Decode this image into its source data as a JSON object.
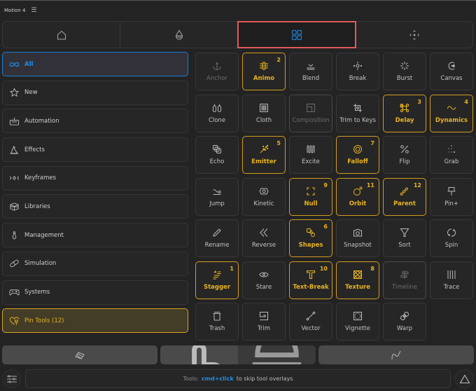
{
  "window": {
    "title": "Motion 4",
    "menu_icon": "hamburger-icon"
  },
  "nav_tabs": [
    {
      "name": "home",
      "icon": "home-icon",
      "active": false
    },
    {
      "name": "layers",
      "icon": "drop-icon",
      "active": false
    },
    {
      "name": "tools",
      "icon": "grid-icon",
      "active": true
    },
    {
      "name": "move",
      "icon": "move-arrows-icon",
      "active": false
    }
  ],
  "categories": [
    {
      "label": "All",
      "icon": "infinity-icon",
      "state": "active"
    },
    {
      "label": "New",
      "icon": "star-icon",
      "state": "normal"
    },
    {
      "label": "Automation",
      "icon": "robot-icon",
      "state": "normal"
    },
    {
      "label": "Effects",
      "icon": "wizard-hat-icon",
      "state": "normal"
    },
    {
      "label": "Keyframes",
      "icon": "keyframe-icon",
      "state": "normal"
    },
    {
      "label": "Libraries",
      "icon": "box-icon",
      "state": "normal"
    },
    {
      "label": "Management",
      "icon": "tie-icon",
      "state": "normal"
    },
    {
      "label": "Simulation",
      "icon": "pill-icon",
      "state": "normal"
    },
    {
      "label": "Systems",
      "icon": "gamepad-icon",
      "state": "normal"
    },
    {
      "label": "Pin Tools (12)",
      "icon": "heart-pin-icon",
      "state": "pinned"
    }
  ],
  "tools": [
    {
      "label": "Anchor",
      "icon": "anchor-icon",
      "state": "disabled",
      "badge": ""
    },
    {
      "label": "Animo",
      "icon": "animo-icon",
      "state": "pinned",
      "badge": "2"
    },
    {
      "label": "Blend",
      "icon": "blend-icon",
      "state": "normal",
      "badge": ""
    },
    {
      "label": "Break",
      "icon": "break-icon",
      "state": "normal",
      "badge": ""
    },
    {
      "label": "Burst",
      "icon": "burst-icon",
      "state": "normal",
      "badge": ""
    },
    {
      "label": "Canvas",
      "icon": "canvas-icon",
      "state": "normal",
      "badge": ""
    },
    {
      "label": "Clone",
      "icon": "clone-icon",
      "state": "normal",
      "badge": ""
    },
    {
      "label": "Cloth",
      "icon": "cloth-icon",
      "state": "normal",
      "badge": ""
    },
    {
      "label": "Composition",
      "icon": "composition-icon",
      "state": "framed",
      "badge": ""
    },
    {
      "label": "Trim to Keys",
      "icon": "crop-icon",
      "state": "normal",
      "badge": ""
    },
    {
      "label": "Delay",
      "icon": "command-icon",
      "state": "pinned",
      "badge": "3"
    },
    {
      "label": "Dynamics",
      "icon": "wave-icon",
      "state": "pinned",
      "badge": "4"
    },
    {
      "label": "Echo",
      "icon": "echo-icon",
      "state": "normal",
      "badge": ""
    },
    {
      "label": "Emitter",
      "icon": "sparkle-icon",
      "state": "pinned",
      "badge": "5"
    },
    {
      "label": "Excite",
      "icon": "excite-icon",
      "state": "normal",
      "badge": ""
    },
    {
      "label": "Falloff",
      "icon": "target-icon",
      "state": "pinned",
      "badge": "7"
    },
    {
      "label": "Flip",
      "icon": "percent-icon",
      "state": "normal",
      "badge": ""
    },
    {
      "label": "Grab",
      "icon": "dots-icon",
      "state": "normal",
      "badge": ""
    },
    {
      "label": "Jump",
      "icon": "jump-icon",
      "state": "normal",
      "badge": ""
    },
    {
      "label": "Kinetic",
      "icon": "kinetic-icon",
      "state": "normal",
      "badge": ""
    },
    {
      "label": "Null",
      "icon": "null-icon",
      "state": "pinned",
      "badge": "9"
    },
    {
      "label": "Orbit",
      "icon": "orbit-icon",
      "state": "pinned",
      "badge": "11"
    },
    {
      "label": "Parent",
      "icon": "chain-icon",
      "state": "pinned",
      "badge": "12"
    },
    {
      "label": "Pin+",
      "icon": "pin-icon",
      "state": "normal",
      "badge": ""
    },
    {
      "label": "Rename",
      "icon": "pencil-icon",
      "state": "normal",
      "badge": ""
    },
    {
      "label": "Reverse",
      "icon": "reverse-icon",
      "state": "normal",
      "badge": ""
    },
    {
      "label": "Shapes",
      "icon": "shapes-icon",
      "state": "pinned",
      "badge": "6"
    },
    {
      "label": "Snapshot",
      "icon": "camera-icon",
      "state": "normal",
      "badge": ""
    },
    {
      "label": "Sort",
      "icon": "funnel-icon",
      "state": "normal",
      "badge": ""
    },
    {
      "label": "Spin",
      "icon": "spin-icon",
      "state": "normal",
      "badge": ""
    },
    {
      "label": "Stagger",
      "icon": "stagger-icon",
      "state": "pinned",
      "badge": "1"
    },
    {
      "label": "Stare",
      "icon": "eye-icon",
      "state": "normal",
      "badge": ""
    },
    {
      "label": "Text-Break",
      "icon": "text-icon",
      "state": "pinned",
      "badge": "10"
    },
    {
      "label": "Texture",
      "icon": "texture-icon",
      "state": "pinned",
      "badge": "8"
    },
    {
      "label": "Timeline",
      "icon": "timeline-icon",
      "state": "framed",
      "badge": ""
    },
    {
      "label": "Trace",
      "icon": "trace-icon",
      "state": "normal",
      "badge": ""
    },
    {
      "label": "Trash",
      "icon": "trash-icon",
      "state": "normal",
      "badge": ""
    },
    {
      "label": "Trim",
      "icon": "trim-icon",
      "state": "normal",
      "badge": ""
    },
    {
      "label": "Vector",
      "icon": "vector-icon",
      "state": "normal",
      "badge": ""
    },
    {
      "label": "Vignette",
      "icon": "vignette-icon",
      "state": "normal",
      "badge": ""
    },
    {
      "label": "Warp",
      "icon": "warp-icon",
      "state": "normal",
      "badge": ""
    }
  ],
  "bottom_bar": {
    "left_icon": "palette-icon",
    "middle_left_icon": "tap-icon",
    "middle_right_icon": "bell-stack-icon",
    "right_icon": "curve-icon"
  },
  "status": {
    "prefix": "Tools:",
    "shortcut": "cmd+click",
    "suffix": "to skip tool overlays"
  },
  "colors": {
    "accent_blue": "#1f8fe8",
    "pinned_gold": "#e8b320",
    "active_tab_outline": "#e05a5a"
  }
}
